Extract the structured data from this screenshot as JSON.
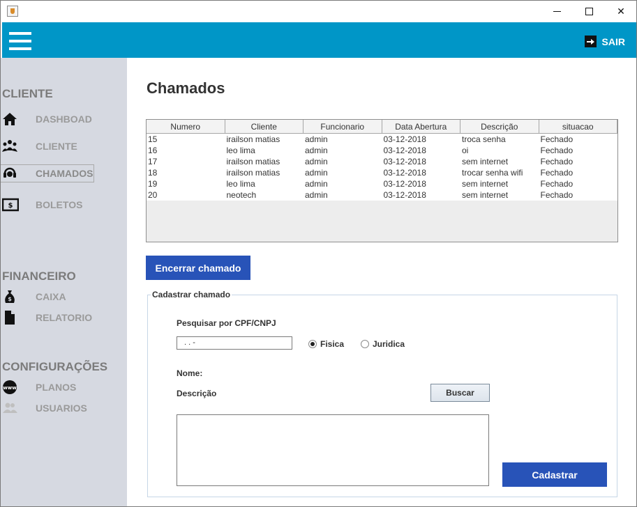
{
  "window": {
    "app_icon": "java-cup-icon",
    "minimize": "—",
    "maximize": "☐",
    "close": "✕"
  },
  "header": {
    "menu_icon": "hamburger-icon",
    "logout_label": "SAIR",
    "color": "#0096c7"
  },
  "sidebar": {
    "sections": {
      "cliente": "CLIENTE",
      "financeiro": "FINANCEIRO",
      "configuracoes": "CONFIGURAÇÕES"
    },
    "items": [
      {
        "label": "DASHBOAD",
        "icon": "home-icon"
      },
      {
        "label": "CLIENTE",
        "icon": "users-group-icon"
      },
      {
        "label": "CHAMADOS",
        "icon": "headset-icon",
        "active": true
      },
      {
        "label": "BOLETOS",
        "icon": "money-bill-icon"
      },
      {
        "label": "CAIXA",
        "icon": "money-bag-icon"
      },
      {
        "label": "RELATORIO",
        "icon": "document-icon"
      },
      {
        "label": "PLANOS",
        "icon": "www-globe-icon"
      },
      {
        "label": "USUARIOS",
        "icon": "users-icon"
      }
    ]
  },
  "main": {
    "title": "Chamados",
    "table": {
      "columns": [
        "Numero",
        "Cliente",
        "Funcionario",
        "Data Abertura",
        "Descrição",
        "situacao"
      ],
      "rows": [
        [
          "15",
          "irailson matias",
          "admin",
          "03-12-2018",
          "troca senha",
          "Fechado"
        ],
        [
          "16",
          "leo lima",
          "admin",
          "03-12-2018",
          "oi",
          "Fechado"
        ],
        [
          "17",
          "irailson matias",
          "admin",
          "03-12-2018",
          "sem internet",
          "Fechado"
        ],
        [
          "18",
          "irailson matias",
          "admin",
          "03-12-2018",
          "trocar senha wifi",
          "Fechado"
        ],
        [
          "19",
          "leo lima",
          "admin",
          "03-12-2018",
          "sem internet",
          "Fechado"
        ],
        [
          "20",
          "neotech",
          "admin",
          "03-12-2018",
          "sem internet",
          "Fechado"
        ]
      ]
    },
    "close_button": "Encerrar chamado",
    "form": {
      "group_title": "Cadastrar chamado",
      "search_label": "Pesquisar por CPF/CNPJ",
      "cpf_value": " .   .   -",
      "radio_fisica": "Fisica",
      "radio_juridica": "Juridica",
      "selected": "Fisica",
      "name_label": "Nome:",
      "description_label": "Descrição",
      "search_button": "Buscar",
      "submit_button": "Cadastrar"
    },
    "accent_color": "#2853b8"
  }
}
